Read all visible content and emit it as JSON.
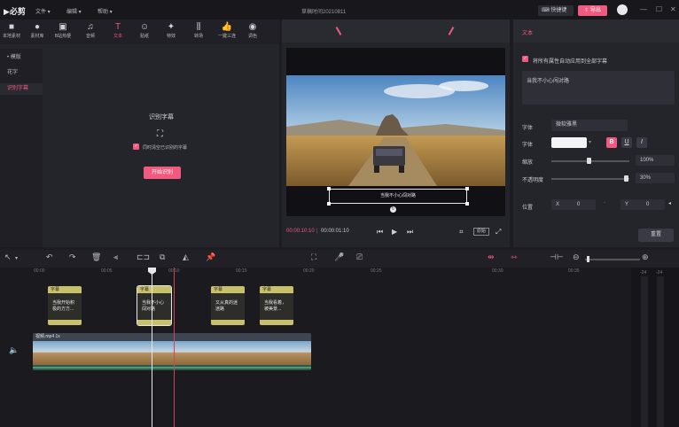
{
  "app": {
    "logo": "必剪",
    "window_title": "草稿时间20210811",
    "menus": [
      "文件 ▾",
      "编辑 ▾",
      "帮助 ▾"
    ],
    "shortcut_btn": "快捷键",
    "export_btn": "导出",
    "win_controls": [
      "—",
      "☐",
      "✕"
    ]
  },
  "toolbar": {
    "items": [
      {
        "label": "本地素材",
        "icon": "■"
      },
      {
        "label": "素材库",
        "icon": "●"
      },
      {
        "label": "B站热梗",
        "icon": "▣"
      },
      {
        "label": "音频",
        "icon": "♫"
      },
      {
        "label": "文本",
        "icon": "T"
      },
      {
        "label": "贴纸",
        "icon": "☺"
      },
      {
        "label": "特效",
        "icon": "✦"
      },
      {
        "label": "转场",
        "icon": "⫼"
      },
      {
        "label": "一键三连",
        "icon": "👍"
      },
      {
        "label": "调色",
        "icon": "◉"
      }
    ]
  },
  "sidebar": {
    "items": [
      {
        "label": "• 模版"
      },
      {
        "label": "花字"
      },
      {
        "label": "识别字幕"
      }
    ]
  },
  "recognize": {
    "title": "识别字幕",
    "checkbox_label": "同时清空已识别的字幕",
    "start_btn": "开始识别"
  },
  "preview": {
    "subtitle_text": "当我不小心闯对路",
    "current_time": "00:00:10:10",
    "total_time": "00:00:01:10",
    "ratio_label": "原始"
  },
  "props": {
    "header": "文本",
    "apply_all_label": "将所有属性自动应用到全部字幕",
    "text_value": "当我不小心闯对路",
    "font_label": "字体",
    "font_value": "微软雅黑",
    "color_label": "字体",
    "bold": "B",
    "underline": "U",
    "italic": "I",
    "scale_label": "缩放",
    "scale_value": "100%",
    "opacity_label": "不透明度",
    "opacity_value": "30%",
    "position_label": "位置",
    "pos_x_label": "X",
    "pos_x_value": "0",
    "pos_y_label": "Y",
    "pos_y_value": "0",
    "reset_btn": "重置"
  },
  "timeline": {
    "ticks": [
      "00:00",
      "00:05",
      "00:10",
      "00:15",
      "00:20",
      "00:25",
      "00:30",
      "00:35"
    ],
    "subtitle_clips": [
      {
        "header": "字幕",
        "text": "当我开始积 极的方方..."
      },
      {
        "header": "字幕",
        "text": "当我不小心 闯对路"
      },
      {
        "header": "字幕",
        "text": "又从真的迷 迷路"
      },
      {
        "header": "字幕",
        "text": "当我看着， 被美景..."
      }
    ],
    "video_clip_label": "视频.mp4   1x",
    "meter_labels": [
      "-24",
      "-24"
    ]
  }
}
